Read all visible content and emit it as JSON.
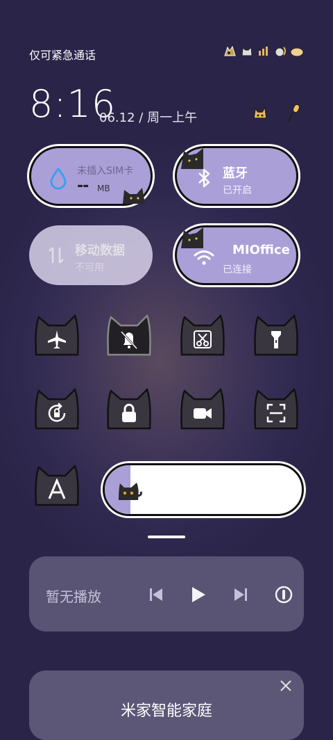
{
  "status": {
    "carrier_text": "仅可紧急通话"
  },
  "clock": {
    "time": "8:16",
    "date": "06.12",
    "date_sep": "/",
    "weekday": "周一上午"
  },
  "tiles": {
    "sim": {
      "title": "未插入SIM卡",
      "value": "--",
      "unit": "MB"
    },
    "bluetooth": {
      "title": "蓝牙",
      "status": "已开启"
    },
    "mobile_data": {
      "title": "移动数据",
      "status": "不可用"
    },
    "wifi": {
      "title": "MIOffice",
      "status": "已连接"
    }
  },
  "toggles": [
    {
      "name": "airplane-mode",
      "icon": "airplane-icon"
    },
    {
      "name": "mute",
      "icon": "bell-off-icon"
    },
    {
      "name": "screenshot",
      "icon": "scissors-icon"
    },
    {
      "name": "flashlight",
      "icon": "flashlight-icon"
    },
    {
      "name": "auto-rotate",
      "icon": "rotate-lock-icon"
    },
    {
      "name": "lock-screen",
      "icon": "lock-icon"
    },
    {
      "name": "screen-record",
      "icon": "video-icon"
    },
    {
      "name": "scan",
      "icon": "scan-icon"
    },
    {
      "name": "font-size",
      "icon": "letter-a-icon"
    }
  ],
  "brightness": {
    "level": 0.13
  },
  "media": {
    "text": "暂无播放"
  },
  "smart_home": {
    "title": "米家智能家庭"
  },
  "colors": {
    "accent": "#ab9fd8",
    "card": "#5c5677",
    "background": "#2f2950"
  }
}
